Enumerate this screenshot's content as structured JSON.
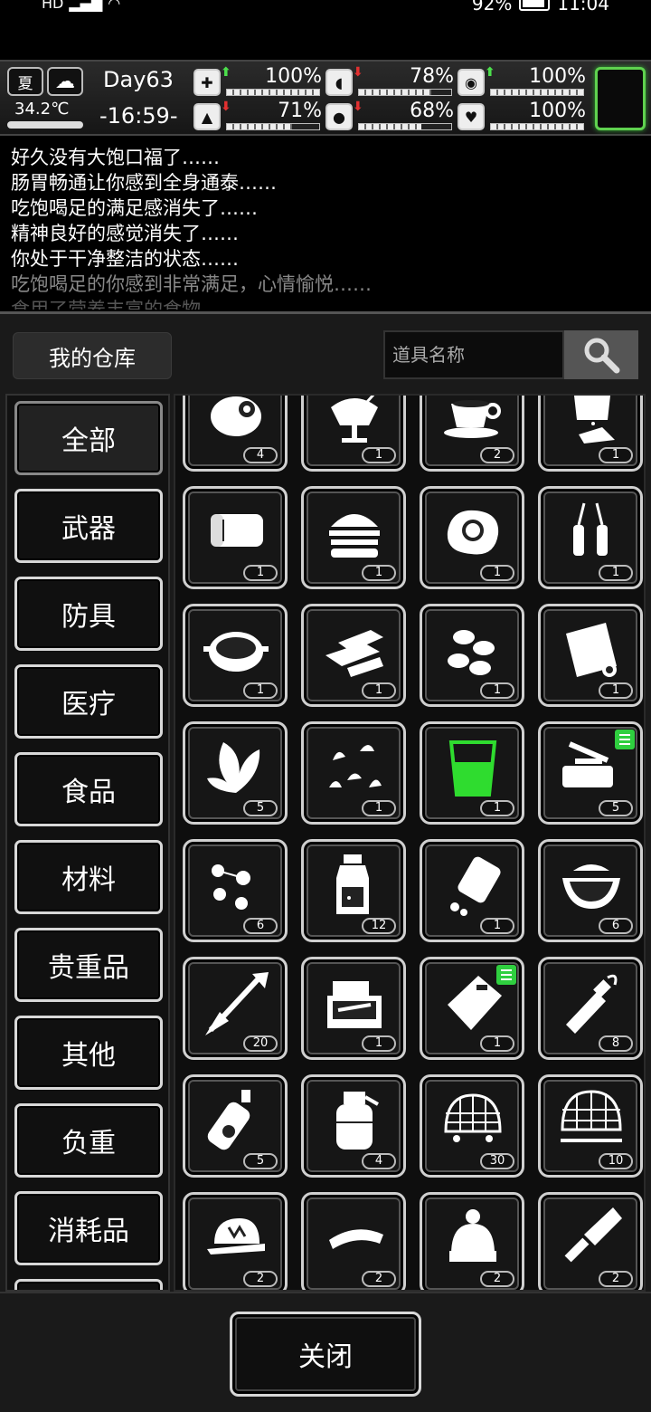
{
  "status_bar": {
    "left": "HD",
    "battery": "92%",
    "time": "11:04"
  },
  "hud": {
    "season": "夏",
    "temperature": "34.2℃",
    "day": "Day63",
    "clock": "-16:59-",
    "stats": [
      {
        "icon": "medkit-icon",
        "symbol": "✚",
        "arrow": "up",
        "value": "100%",
        "level": 1.0
      },
      {
        "icon": "stomach-icon",
        "symbol": "◖",
        "arrow": "down",
        "value": "78%",
        "level": 0.78
      },
      {
        "icon": "hygiene-icon",
        "symbol": "◉",
        "arrow": "up",
        "value": "100%",
        "level": 1.0
      },
      {
        "icon": "stamina-icon",
        "symbol": "▲",
        "arrow": "down",
        "value": "71%",
        "level": 0.71
      },
      {
        "icon": "water-drop-icon",
        "symbol": "●",
        "arrow": "down",
        "value": "68%",
        "level": 0.68
      },
      {
        "icon": "heart-icon",
        "symbol": "♥",
        "arrow": "none",
        "value": "100%",
        "level": 1.0
      }
    ]
  },
  "log": [
    "好久没有大饱口福了……",
    "肠胃畅通让你感到全身通泰……",
    "吃饱喝足的满足感消失了……",
    "精神良好的感觉消失了……",
    "你处于干净整洁的状态……",
    "吃饱喝足的你感到非常满足，心情愉悦……",
    "食用了营养丰富的食物……"
  ],
  "warehouse": {
    "title": "我的仓库",
    "search_placeholder": "道具名称",
    "categories": [
      "全部",
      "武器",
      "防具",
      "医疗",
      "食品",
      "材料",
      "贵重品",
      "其他",
      "负重",
      "消耗品",
      ""
    ],
    "items": [
      {
        "name": "meat-icon",
        "count": "4"
      },
      {
        "name": "sundae-icon",
        "count": "1"
      },
      {
        "name": "coffee-cup-icon",
        "count": "2"
      },
      {
        "name": "sugar-bag-icon",
        "count": "1"
      },
      {
        "name": "bandage-icon",
        "count": "1"
      },
      {
        "name": "burger-icon",
        "count": "1"
      },
      {
        "name": "fried-egg-icon",
        "count": "1"
      },
      {
        "name": "ampoule-icon",
        "count": "1"
      },
      {
        "name": "stew-pot-icon",
        "count": "1"
      },
      {
        "name": "gold-bar-icon",
        "count": "1"
      },
      {
        "name": "almond-icon",
        "count": "1"
      },
      {
        "name": "paper-roll-icon",
        "count": "1"
      },
      {
        "name": "leaf-icon",
        "count": "5"
      },
      {
        "name": "herbs-icon",
        "count": "1"
      },
      {
        "name": "green-drink-icon",
        "count": "1"
      },
      {
        "name": "dropper-kit-icon",
        "count": "5",
        "badge": true
      },
      {
        "name": "berries-icon",
        "count": "6"
      },
      {
        "name": "medicine-bottle-icon",
        "count": "12"
      },
      {
        "name": "pill-bottle-icon",
        "count": "1"
      },
      {
        "name": "watermelon-icon",
        "count": "6"
      },
      {
        "name": "arrow-icon",
        "count": "20"
      },
      {
        "name": "repair-kit-icon",
        "count": "1"
      },
      {
        "name": "ration-pack-icon",
        "count": "1",
        "badge": true
      },
      {
        "name": "molotov-icon",
        "count": "8"
      },
      {
        "name": "spray-can-icon",
        "count": "5"
      },
      {
        "name": "grenade-icon",
        "count": "4"
      },
      {
        "name": "net-icon",
        "count": "30"
      },
      {
        "name": "trap-net-icon",
        "count": "10"
      },
      {
        "name": "cap-icon",
        "count": "2"
      },
      {
        "name": "visor-icon",
        "count": "2"
      },
      {
        "name": "beanie-icon",
        "count": "2"
      },
      {
        "name": "cleaver-icon",
        "count": "2"
      }
    ],
    "close_label": "关闭"
  }
}
